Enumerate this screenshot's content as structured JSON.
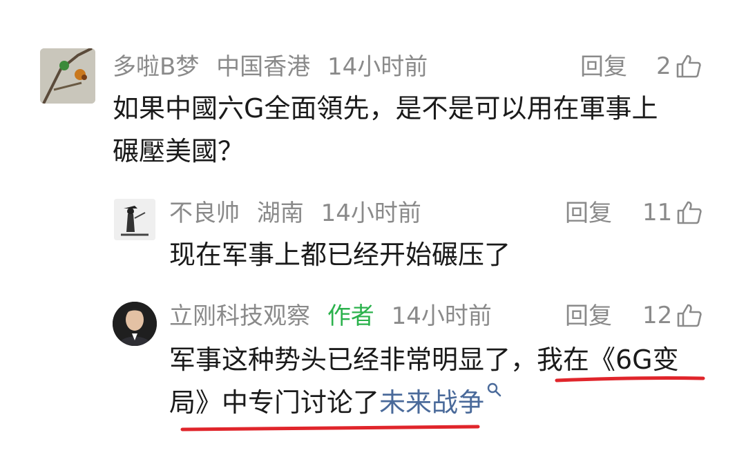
{
  "comments": [
    {
      "username": "多啦B梦",
      "location": "中国香港",
      "time": "14小时前",
      "reply_label": "回复",
      "likes": "2",
      "text_lines": [
        "如果中國六G全面領先，是不是可以用在軍事上",
        "碾壓美國？"
      ]
    },
    {
      "username": "不良帅",
      "location": "湖南",
      "time": "14小时前",
      "reply_label": "回复",
      "likes": "11",
      "text": "现在军事上都已经开始碾压了"
    },
    {
      "username": "立刚科技观察",
      "badge": "作者",
      "time": "14小时前",
      "reply_label": "回复",
      "likes": "12",
      "line1": "军事这种势头已经非常明显了，我在《6G变",
      "line2_prefix": "局》中专门讨论了",
      "line2_link": "未来战争"
    }
  ],
  "colors": {
    "meta_gray": "#8a8a8a",
    "author_green": "#2bb24c",
    "link_blue": "#4a6a9a",
    "underline_red": "#e0252b"
  },
  "icons": [
    "thumbs-up-icon",
    "search-icon"
  ]
}
